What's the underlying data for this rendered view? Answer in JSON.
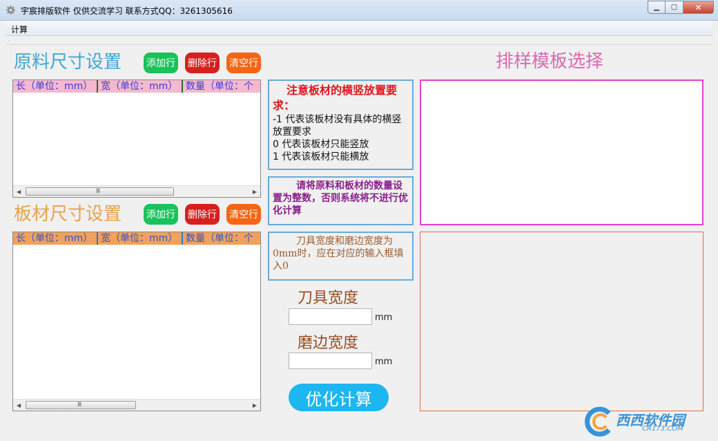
{
  "window": {
    "title": "宇宸排版软件  仅供交流学习  联系方式QQ：3261305616",
    "min_label": "▁",
    "max_label": "▢",
    "close_label": "✕"
  },
  "menu": {
    "items": [
      "计算"
    ]
  },
  "raw": {
    "title": "原料尺寸设置",
    "add_label": "添加行",
    "delete_label": "删除行",
    "clear_label": "清空行",
    "columns": [
      "长（单位：mm）",
      "宽（单位：mm）",
      "数量（单位：个"
    ],
    "scroll_grip": "Ⅲ"
  },
  "board": {
    "title": "板材尺寸设置",
    "add_label": "添加行",
    "delete_label": "删除行",
    "clear_label": "清空行",
    "columns": [
      "长（单位：mm）",
      "宽（单位：mm）",
      "数量（单位：个"
    ],
    "scroll_grip": "Ⅲ"
  },
  "notice1": {
    "heading": "注意板材的横竖放置要求：",
    "lines": [
      "-1 代表该板材没有具体的横竖放置要求",
      "0   代表该板材只能竖放",
      "1   代表该板材只能横放"
    ]
  },
  "notice2": {
    "text": "请将原料和板材的数量设置为整数，否则系统将不进行优化计算"
  },
  "notice3": {
    "text": "刀具宽度和磨边宽度为0mm时，应在对应的输入框填入0"
  },
  "inputs": {
    "blade_label": "刀具宽度",
    "blade_unit": "mm",
    "edge_label": "磨边宽度",
    "edge_unit": "mm"
  },
  "calc_label": "优化计算",
  "template": {
    "title": "排样模板选择"
  },
  "watermark": {
    "text": "西西软件园",
    "sub": "CR173.COM"
  }
}
